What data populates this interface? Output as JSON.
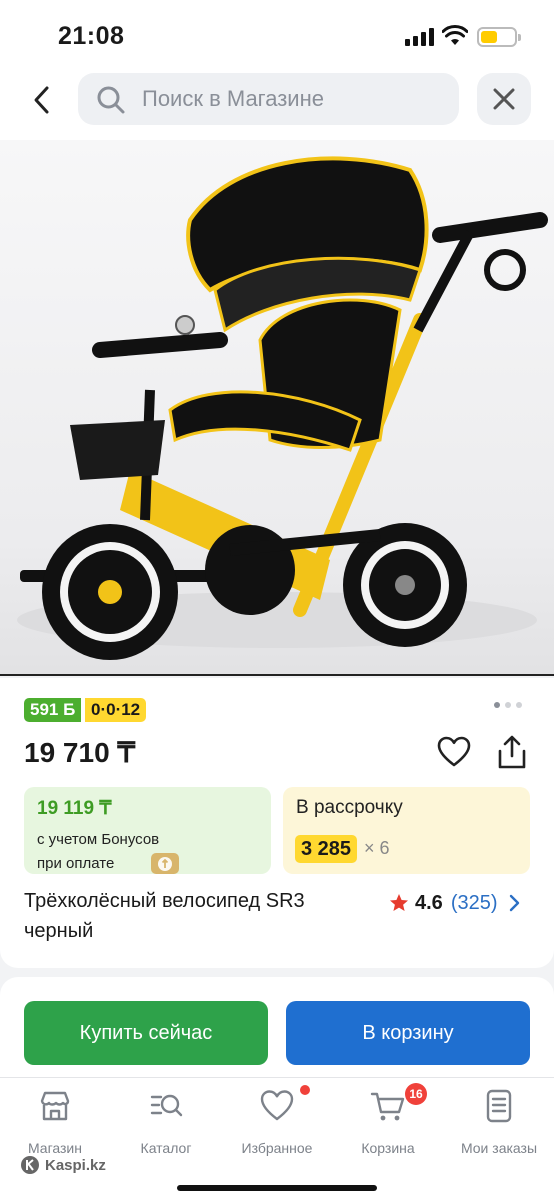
{
  "status_bar": {
    "time": "21:08"
  },
  "header": {
    "search_placeholder": "Поиск в Магазине"
  },
  "product": {
    "image_alt": "Трёхколёсный велосипед SR3 черный",
    "badge_bonus": "591 Б",
    "badge_installment": "0·0·12",
    "price": "19 710 ₸",
    "bonus_price": "19 119 ₸",
    "bonus_line1": "с учетом Бонусов",
    "bonus_line2": "при оплате",
    "installment_title": "В рассрочку",
    "installment_amount": "3 285",
    "installment_multiplier": "× 6",
    "title_line1": "Трёхколёсный велосипед SR3",
    "title_line2": "черный",
    "rating_value": "4.6",
    "rating_count": "(325)",
    "gallery_dots": 3,
    "gallery_active": 1
  },
  "actions": {
    "buy_label": "Купить сейчас",
    "cart_label": "В корзину"
  },
  "nav": {
    "items": [
      {
        "label": "Магазин",
        "icon": "store-icon"
      },
      {
        "label": "Каталог",
        "icon": "catalog-search-icon"
      },
      {
        "label": "Избранное",
        "icon": "heart-icon"
      },
      {
        "label": "Корзина",
        "icon": "cart-icon"
      },
      {
        "label": "Мои заказы",
        "icon": "orders-icon"
      }
    ],
    "cart_count": "16"
  },
  "watermark": "Kaspi.kz",
  "colors": {
    "green": "#2ea24a",
    "blue": "#1f6fd0",
    "yellow": "#ffd830",
    "bonus_green": "#4cae2f",
    "badge_red": "#f0413a",
    "link_blue": "#2b6fc4"
  }
}
